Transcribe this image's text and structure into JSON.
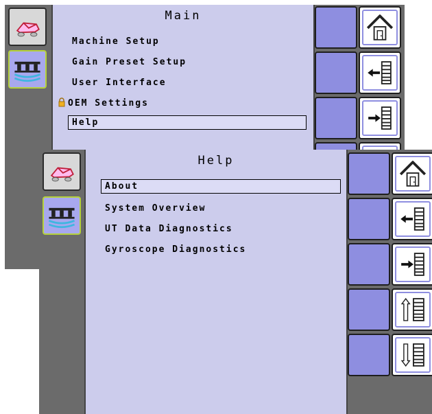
{
  "back_screen": {
    "title": "Main",
    "items": [
      {
        "label": "Machine Setup"
      },
      {
        "label": "Gain Preset Setup"
      },
      {
        "label": "User Interface"
      },
      {
        "label": "OEM Settings",
        "locked": true
      },
      {
        "label": "Help",
        "selected": true
      }
    ]
  },
  "front_screen": {
    "title": "Help",
    "items": [
      {
        "label": "About",
        "selected": true
      },
      {
        "label": "System Overview"
      },
      {
        "label": "UT Data Diagnostics"
      },
      {
        "label": "Gyroscope Diagnostics"
      }
    ]
  },
  "left_tabs": [
    {
      "icon": "vehicle-icon"
    },
    {
      "icon": "boom-sprayer-icon"
    }
  ],
  "right_buttons": [
    {
      "icon": "home-icon"
    },
    {
      "icon": "back-arrow-list-icon"
    },
    {
      "icon": "forward-arrow-list-icon"
    },
    {
      "icon": "scroll-up-icon"
    },
    {
      "icon": "scroll-down-icon"
    }
  ],
  "colors": {
    "panel": "#ccccec",
    "button_blue": "#8e8ee0",
    "active_tab_border": "#b6d23a",
    "frame": "#6b6b6b"
  }
}
